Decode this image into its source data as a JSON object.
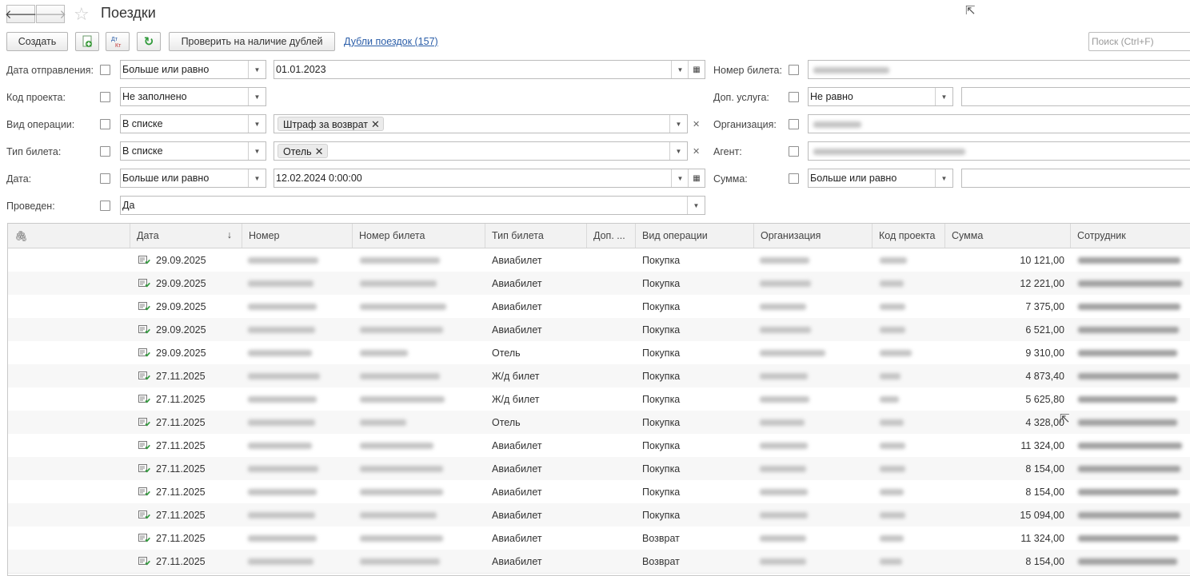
{
  "window": {
    "title": "Поездки"
  },
  "toolbar": {
    "create_label": "Создать",
    "check_duplicates_label": "Проверить на наличие дублей",
    "duplicates_link": "Дубли поездок (157)",
    "search_placeholder": "Поиск (Ctrl+F)",
    "dtkt_icon_text": "Дт Кт"
  },
  "filters": {
    "departure_date": {
      "label": "Дата отправления:",
      "operator": "Больше или равно",
      "value": "01.01.2023"
    },
    "project_code": {
      "label": "Код проекта:",
      "operator": "Не заполнено"
    },
    "operation_type": {
      "label": "Вид операции:",
      "operator": "В списке",
      "tag": "Штраф за возврат"
    },
    "ticket_type": {
      "label": "Тип билета:",
      "operator": "В списке",
      "tag": "Отель"
    },
    "date": {
      "label": "Дата:",
      "operator": "Больше или равно",
      "value": "12.02.2024  0:00:00"
    },
    "posted": {
      "label": "Проведен:",
      "value": "Да"
    },
    "ticket_number": {
      "label": "Номер билета:"
    },
    "extra_service": {
      "label": "Доп. услуга:",
      "operator": "Не равно"
    },
    "organization": {
      "label": "Организация:"
    },
    "agent": {
      "label": "Агент:"
    },
    "amount": {
      "label": "Сумма:",
      "operator": "Больше или равно"
    }
  },
  "table": {
    "columns": [
      "Дата",
      "Номер",
      "Номер билета",
      "Тип билета",
      "Доп. ...",
      "Вид операции",
      "Организация",
      "Код проекта",
      "Сумма",
      "Сотрудник"
    ],
    "sort_indicator": "↓",
    "rows": [
      {
        "date": "29.09.2025",
        "ticket_type": "Авиабилет",
        "operation": "Покупка",
        "amount": "10 121,00"
      },
      {
        "date": "29.09.2025",
        "ticket_type": "Авиабилет",
        "operation": "Покупка",
        "amount": "12 221,00"
      },
      {
        "date": "29.09.2025",
        "ticket_type": "Авиабилет",
        "operation": "Покупка",
        "amount": "7 375,00"
      },
      {
        "date": "29.09.2025",
        "ticket_type": "Авиабилет",
        "operation": "Покупка",
        "amount": "6 521,00"
      },
      {
        "date": "29.09.2025",
        "ticket_type": "Отель",
        "operation": "Покупка",
        "amount": "9 310,00"
      },
      {
        "date": "27.11.2025",
        "ticket_type": "Ж/д билет",
        "operation": "Покупка",
        "amount": "4 873,40"
      },
      {
        "date": "27.11.2025",
        "ticket_type": "Ж/д билет",
        "operation": "Покупка",
        "amount": "5 625,80"
      },
      {
        "date": "27.11.2025",
        "ticket_type": "Отель",
        "operation": "Покупка",
        "amount": "4 328,00"
      },
      {
        "date": "27.11.2025",
        "ticket_type": "Авиабилет",
        "operation": "Покупка",
        "amount": "11 324,00"
      },
      {
        "date": "27.11.2025",
        "ticket_type": "Авиабилет",
        "operation": "Покупка",
        "amount": "8 154,00"
      },
      {
        "date": "27.11.2025",
        "ticket_type": "Авиабилет",
        "operation": "Покупка",
        "amount": "8 154,00"
      },
      {
        "date": "27.11.2025",
        "ticket_type": "Авиабилет",
        "operation": "Покупка",
        "amount": "15 094,00"
      },
      {
        "date": "27.11.2025",
        "ticket_type": "Авиабилет",
        "operation": "Возврат",
        "amount": "11 324,00"
      },
      {
        "date": "27.11.2025",
        "ticket_type": "Авиабилет",
        "operation": "Возврат",
        "amount": "8 154,00"
      }
    ]
  }
}
